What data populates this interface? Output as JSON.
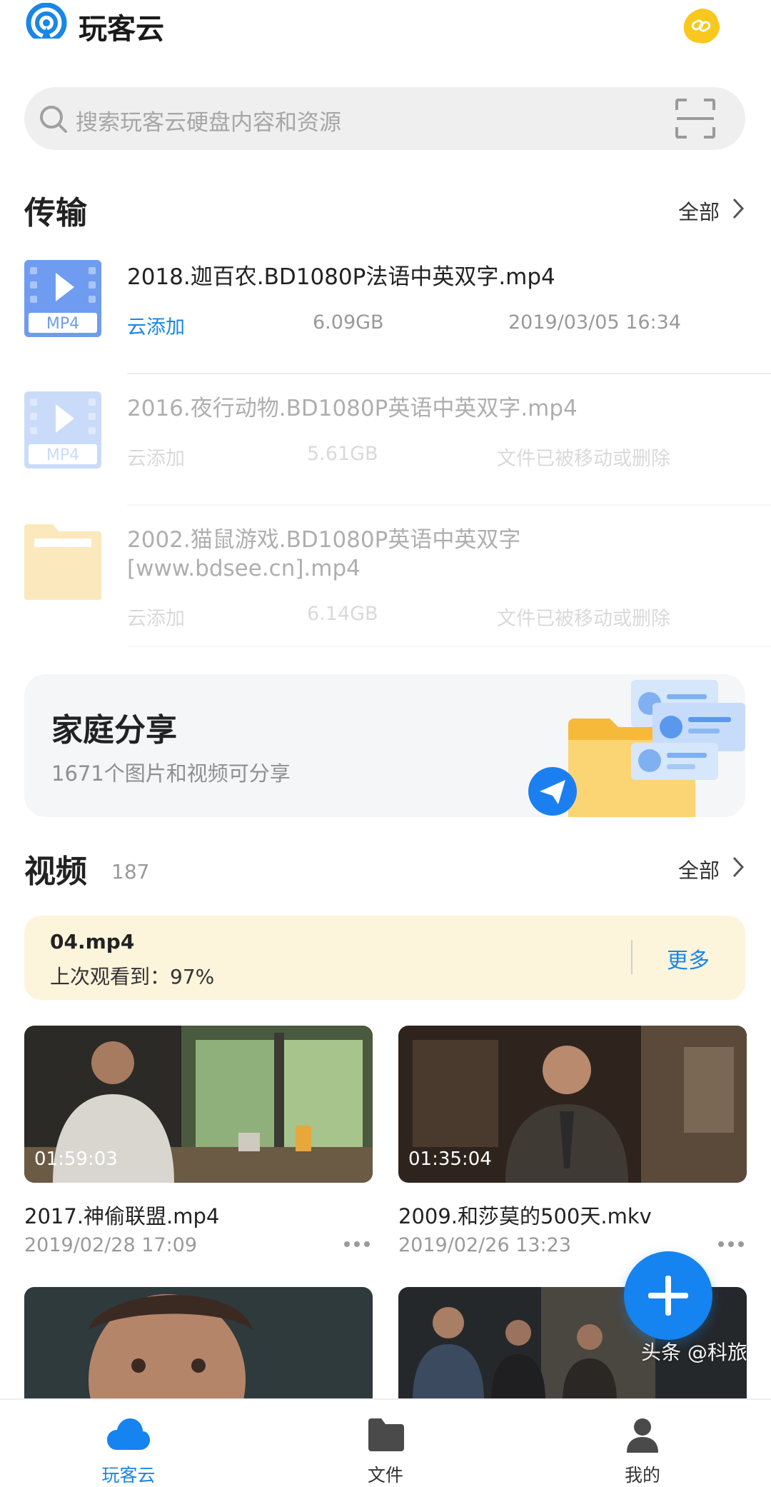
{
  "header": {
    "app_title": "玩客云",
    "logo_icon": "wankeyun-logo-icon",
    "link_icon": "link-badge-icon",
    "accent": "#1a86e6"
  },
  "search": {
    "placeholder": "搜索玩客云硬盘内容和资源"
  },
  "transfer": {
    "title": "传输",
    "all_label": "全部",
    "items": [
      {
        "name": "2018.迦百农.BD1080P法语中英双字.mp4",
        "type": "MP4",
        "source": "云添加",
        "size": "6.09GB",
        "status": "2019/03/05  16:34",
        "dim": false
      },
      {
        "name": "2016.夜行动物.BD1080P英语中英双字.mp4",
        "type": "MP4",
        "source": "云添加",
        "size": "5.61GB",
        "status": "文件已被移动或删除",
        "dim": true
      },
      {
        "name_line1": "2002.猫鼠游戏.BD1080P英语中英双字",
        "name_line2": "[www.bdsee.cn].mp4",
        "type": "folder",
        "source": "云添加",
        "size": "6.14GB",
        "status": "文件已被移动或删除",
        "dim": true
      }
    ]
  },
  "family_share": {
    "title": "家庭分享",
    "subtitle": "1671个图片和视频可分享"
  },
  "videos": {
    "title": "视频",
    "count": "187",
    "all_label": "全部",
    "resume": {
      "file": "04.mp4",
      "progress": "上次观看到：97%",
      "more": "更多"
    },
    "items": [
      {
        "name": "2017.神偷联盟.mp4",
        "date": "2019/02/28 17:09",
        "duration": "01:59:03"
      },
      {
        "name": "2009.和莎莫的500天.mkv",
        "date": "2019/02/26 13:23",
        "duration": "01:35:04"
      }
    ]
  },
  "bottom_nav": {
    "items": [
      {
        "label": "玩客云",
        "icon": "cloud-icon",
        "active": true
      },
      {
        "label": "文件",
        "icon": "folder-icon",
        "active": false
      },
      {
        "label": "我的",
        "icon": "profile-icon",
        "active": false
      }
    ]
  },
  "watermark": "头条 @科旅"
}
